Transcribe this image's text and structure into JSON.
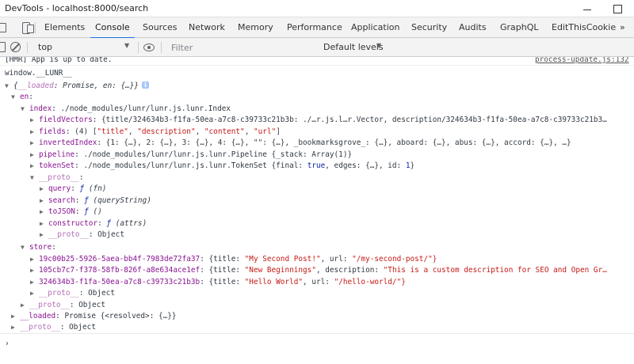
{
  "window": {
    "title": "DevTools - localhost:8000/search"
  },
  "tabs": [
    {
      "label": "Elements"
    },
    {
      "label": "Console"
    },
    {
      "label": "Sources"
    },
    {
      "label": "Network"
    },
    {
      "label": "Memory"
    },
    {
      "label": "Performance"
    },
    {
      "label": "Application"
    },
    {
      "label": "Security"
    },
    {
      "label": "Audits"
    },
    {
      "label": "GraphQL"
    },
    {
      "label": "EditThisCookie"
    }
  ],
  "active_tab": "Console",
  "more_tabs": "»",
  "toolbar": {
    "context": "top",
    "filter_placeholder": "Filter",
    "levels": "Default levels"
  },
  "console": {
    "hmr_message": "[HMR] App is up to date.",
    "hmr_source": "process-update.js:132",
    "command": "window.__LUNR__",
    "root_preview_key": "__loaded",
    "root_preview_type": "Promise",
    "root_preview_rest": "en: {…}}",
    "en_key": "en",
    "index": {
      "key": "index",
      "value": "./node_modules/lunr/lunr.js.lunr.Index",
      "fieldVectors_key": "fieldVectors",
      "fieldVectors_value": "{title/324634b3-f1fa-50ea-a7c8-c39733c21b3b: ./…r.js.l…r.Vector, description/324634b3-f1fa-50ea-a7c8-c39733c21b3…",
      "fields_key": "fields",
      "fields_count": "(4)",
      "fields_values": [
        "\"title\"",
        "\"description\"",
        "\"content\"",
        "\"url\""
      ],
      "invertedIndex_key": "invertedIndex",
      "invertedIndex_value": "{1: {…}, 2: {…}, 3: {…}, 4: {…}, \"\": {…}, _bookmarksgrove_: {…}, aboard: {…}, abus: {…}, accord: {…}, …}",
      "pipeline_key": "pipeline",
      "pipeline_value": "./node_modules/lunr/lunr.js.lunr.Pipeline {_stack: Array(1)}",
      "tokenSet_key": "tokenSet",
      "tokenSet_value_pre": "./node_modules/lunr/lunr.js.lunr.TokenSet {final:",
      "tokenSet_true": "true",
      "tokenSet_value_post": ", edges: {…}, id:",
      "tokenSet_id": "1",
      "proto_key": "__proto__",
      "proto_items": [
        {
          "key": "query",
          "sig": "(fn)"
        },
        {
          "key": "search",
          "sig": "(queryString)"
        },
        {
          "key": "toJSON",
          "sig": "()"
        },
        {
          "key": "constructor",
          "sig": "(attrs)"
        }
      ],
      "proto_proto_value": "Object"
    },
    "store": {
      "key": "store",
      "entries": [
        {
          "id": "19c00b25-5926-5aea-bb4f-7983de72fa37",
          "title": "\"My Second Post!\"",
          "rest_key": "url",
          "rest_value": "\"/my-second-post/\"}"
        },
        {
          "id": "105cb7c7-f378-58fb-826f-a8e634ace1ef",
          "title": "\"New Beginnings\"",
          "rest_key": "description",
          "rest_value": "\"This is a custom description for SEO and Open Gr…"
        },
        {
          "id": "324634b3-f1fa-50ea-a7c8-c39733c21b3b",
          "title": "\"Hello World\"",
          "rest_key": "url",
          "rest_value": "\"/hello-world/\"}"
        }
      ],
      "proto_value": "Object"
    },
    "en_proto_value": "Object",
    "loaded_key": "__loaded",
    "loaded_value": "Promise {<resolved>: {…}}",
    "root_proto_value": "Object",
    "func_glyph": "ƒ",
    "proto_label": "__proto__"
  }
}
